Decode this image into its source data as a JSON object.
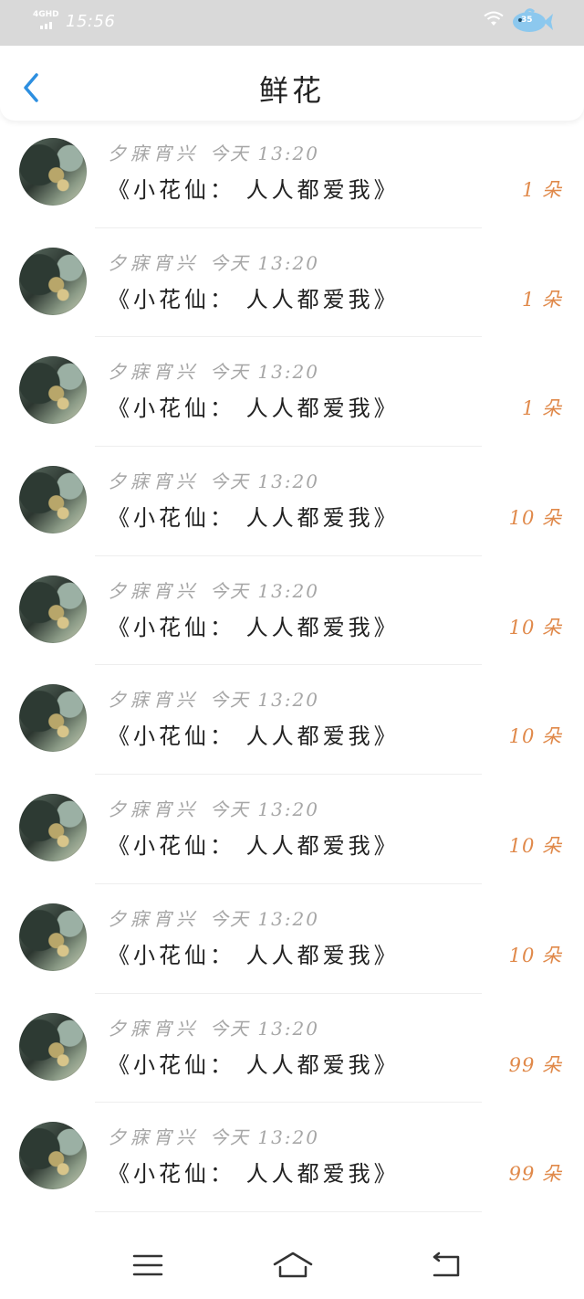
{
  "status_bar": {
    "network": "4GHD",
    "time": "15:56",
    "battery": "35",
    "icons": [
      "signal-icon",
      "wifi-icon",
      "battery-fish-icon"
    ]
  },
  "header": {
    "title": "鲜花",
    "back_icon": "back-chevron-icon"
  },
  "gifts": [
    {
      "sender": "夕寐宵兴",
      "time": "今天 13:20",
      "book": "《小花仙： 人人都爱我》",
      "amount": "1 朵"
    },
    {
      "sender": "夕寐宵兴",
      "time": "今天 13:20",
      "book": "《小花仙： 人人都爱我》",
      "amount": "1 朵"
    },
    {
      "sender": "夕寐宵兴",
      "time": "今天 13:20",
      "book": "《小花仙： 人人都爱我》",
      "amount": "1 朵"
    },
    {
      "sender": "夕寐宵兴",
      "time": "今天 13:20",
      "book": "《小花仙： 人人都爱我》",
      "amount": "10 朵"
    },
    {
      "sender": "夕寐宵兴",
      "time": "今天 13:20",
      "book": "《小花仙： 人人都爱我》",
      "amount": "10 朵"
    },
    {
      "sender": "夕寐宵兴",
      "time": "今天 13:20",
      "book": "《小花仙： 人人都爱我》",
      "amount": "10 朵"
    },
    {
      "sender": "夕寐宵兴",
      "time": "今天 13:20",
      "book": "《小花仙： 人人都爱我》",
      "amount": "10 朵"
    },
    {
      "sender": "夕寐宵兴",
      "time": "今天 13:20",
      "book": "《小花仙： 人人都爱我》",
      "amount": "10 朵"
    },
    {
      "sender": "夕寐宵兴",
      "time": "今天 13:20",
      "book": "《小花仙： 人人都爱我》",
      "amount": "99 朵"
    },
    {
      "sender": "夕寐宵兴",
      "time": "今天 13:20",
      "book": "《小花仙： 人人都爱我》",
      "amount": "99 朵"
    }
  ],
  "nav_bar": {
    "icons": [
      "menu-icon",
      "home-icon",
      "back-icon"
    ]
  },
  "colors": {
    "accent": "#2d8fe0",
    "amount": "#e0894a",
    "meta": "#a6a6a6",
    "status_bar": "#d9d9d9"
  }
}
